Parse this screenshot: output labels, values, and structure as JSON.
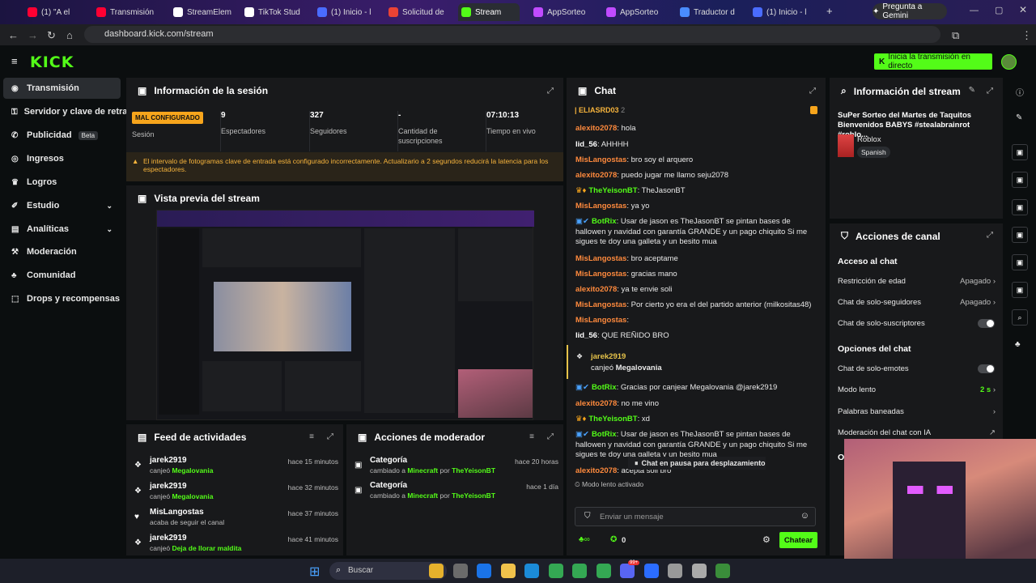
{
  "browser": {
    "tabs": [
      {
        "label": "(1) \"A el",
        "color": "#ff0033"
      },
      {
        "label": "Transmisión",
        "color": "#ff0033"
      },
      {
        "label": "StreamElem",
        "color": "#ffffff"
      },
      {
        "label": "TikTok Stud",
        "color": "#ffffff"
      },
      {
        "label": "(1) Inicio - l",
        "color": "#4a6cff"
      },
      {
        "label": "Solicitud de",
        "color": "#ea4335"
      },
      {
        "label": "Stream",
        "color": "#53fc18"
      },
      {
        "label": "AppSorteo",
        "color": "#c04bff"
      },
      {
        "label": "AppSorteo",
        "color": "#c04bff"
      },
      {
        "label": "Traductor d",
        "color": "#4a8cff"
      },
      {
        "label": "(1) Inicio - l",
        "color": "#4a6cff"
      }
    ],
    "gemini_button": "Pregunta a Gemini",
    "url": "dashboard.kick.com/stream"
  },
  "header": {
    "logo": "KICK",
    "go_live": "Inicia la transmisión en directo"
  },
  "sidebar": {
    "items": [
      {
        "label": "Transmisión",
        "icon": "broadcast-icon"
      },
      {
        "label": "Servidor y clave de retran",
        "icon": "key-icon"
      },
      {
        "label": "Publicidad",
        "badge": "Beta",
        "icon": "megaphone-icon"
      },
      {
        "label": "Ingresos",
        "icon": "coin-icon"
      },
      {
        "label": "Logros",
        "icon": "trophy-icon"
      },
      {
        "label": "Estudio",
        "icon": "brush-icon"
      },
      {
        "label": "Analíticas",
        "icon": "chart-icon"
      },
      {
        "label": "Moderación",
        "icon": "hammer-icon"
      },
      {
        "label": "Comunidad",
        "icon": "community-icon"
      },
      {
        "label": "Drops y recompensas",
        "icon": "gift-icon"
      }
    ]
  },
  "session": {
    "title": "Información de la sesión",
    "status_badge": "MAL CONFIGURADO",
    "status_label": "Sesión",
    "stats": [
      {
        "value": "9",
        "label": "Espectadores"
      },
      {
        "value": "327",
        "label": "Seguidores"
      },
      {
        "value": "-",
        "label": "Cantidad de suscripciones"
      },
      {
        "value": "07:10:13",
        "label": "Tiempo en vivo"
      }
    ],
    "warning": "El intervalo de fotogramas clave de entrada está configurado incorrectamente. Actualizario a 2 segundos reducirá la latencia para los espectadores."
  },
  "preview": {
    "title": "Vista previa del stream"
  },
  "feed": {
    "title": "Feed de actividades",
    "items": [
      {
        "name": "jarek2919",
        "action": "canjeó",
        "target": "Megalovania",
        "time": "hace 15 minutos"
      },
      {
        "name": "jarek2919",
        "action": "canjeó",
        "target": "Megalovania",
        "time": "hace 32 minutos"
      },
      {
        "name": "MisLangostas",
        "action": "acaba de seguir el canal",
        "target": "",
        "time": "hace 37 minutos"
      },
      {
        "name": "jarek2919",
        "action": "canjeó",
        "target": "Deja de llorar maldita",
        "time": "hace 41 minutos"
      }
    ]
  },
  "modactions": {
    "title": "Acciones de moderador",
    "items": [
      {
        "name": "Categoría",
        "prefix": "cambiado a",
        "target": "Minecraft",
        "by": "por",
        "mod": "TheYeisonBT",
        "time": "hace 20 horas"
      },
      {
        "name": "Categoría",
        "prefix": "cambiado a",
        "target": "Minecraft",
        "by": "por",
        "mod": "TheYeisonBT",
        "time": "hace 1 día"
      }
    ]
  },
  "chat": {
    "title": "Chat",
    "pinned": "ELIASRD03",
    "pinned_count": "2",
    "messages": [
      {
        "user": "alexito2078",
        "color": "#ff8a3d",
        "text": "hola"
      },
      {
        "user": "lid_56",
        "color": "#ffffff",
        "text": "AHHHH"
      },
      {
        "user": "MisLangostas",
        "color": "#ff8a3d",
        "text": "bro soy el arquero"
      },
      {
        "user": "alexito2078",
        "color": "#ff8a3d",
        "text": "puedo jugar me llamo seju2078"
      },
      {
        "user": "TheYeisonBT",
        "color": "#53fc18",
        "text": "TheJasonBT"
      },
      {
        "user": "MisLangostas",
        "color": "#ff8a3d",
        "text": "ya yo"
      },
      {
        "user": "BotRix",
        "color": "#53fc18",
        "text": "Usar de jason es TheJasonBT se pintan bases de hallowen y navidad con garantía GRANDE y un pago chiquito Si me sigues te doy una galleta y un besito mua"
      },
      {
        "user": "MisLangostas",
        "color": "#ff8a3d",
        "text": "bro aceptame"
      },
      {
        "user": "MisLangostas",
        "color": "#ff8a3d",
        "text": "gracias mano"
      },
      {
        "user": "alexito2078",
        "color": "#ff8a3d",
        "text": "ya te envie soli"
      },
      {
        "user": "MisLangostas",
        "color": "#ff8a3d",
        "text": "Por cierto yo era el del partido anterior (milkositas48)"
      },
      {
        "user": "MisLangostas",
        "color": "#ff8a3d",
        "text": ""
      },
      {
        "user": "lid_56",
        "color": "#ffffff",
        "text": "QUE REÑIDO BRO"
      }
    ],
    "redeem": {
      "user": "jarek2919",
      "action": "canjeó",
      "reward": "Megalovania"
    },
    "messages2": [
      {
        "user": "BotRix",
        "color": "#53fc18",
        "text": "Gracias por canjear Megalovania @jarek2919"
      },
      {
        "user": "alexito2078",
        "color": "#ff8a3d",
        "text": "no me vino"
      },
      {
        "user": "TheYeisonBT",
        "color": "#53fc18",
        "text": "xd"
      },
      {
        "user": "BotRix",
        "color": "#53fc18",
        "text": "Usar de jason es TheJasonBT se pintan bases de hallowen y navidad con garantía GRANDE y un pago chiquito Si me sigues te doy una galleta y un besito mua"
      },
      {
        "user": "alexito2078",
        "color": "#ff8a3d",
        "text": "acepta soli bro"
      }
    ],
    "paused": "Chat en pausa para desplazamiento",
    "slow_mode": "Modo lento activado",
    "input_placeholder": "Enviar un mensaje",
    "points": "0",
    "send_button": "Chatear"
  },
  "streaminfo": {
    "title": "Información del stream",
    "stream_title": "SuPer Sorteo del Martes de Taquitos Bienvenidos BABYS #stealabrainrot #roblo...",
    "category": "Roblox",
    "language": "Spanish"
  },
  "channel": {
    "title": "Acciones de canal",
    "section1": "Acceso al chat",
    "age": "Restricción de edad",
    "age_value": "Apagado",
    "followers": "Chat de solo-seguidores",
    "followers_value": "Apagado",
    "subs": "Chat de solo-suscriptores",
    "section2": "Opciones del chat",
    "emotes": "Chat de solo-emotes",
    "slow": "Modo lento",
    "slow_value": "2 s",
    "banned": "Palabras baneadas",
    "ai": "Moderación del chat con IA",
    "section3": "Op"
  },
  "taskbar": {
    "search": "Buscar",
    "badge": "99+"
  }
}
